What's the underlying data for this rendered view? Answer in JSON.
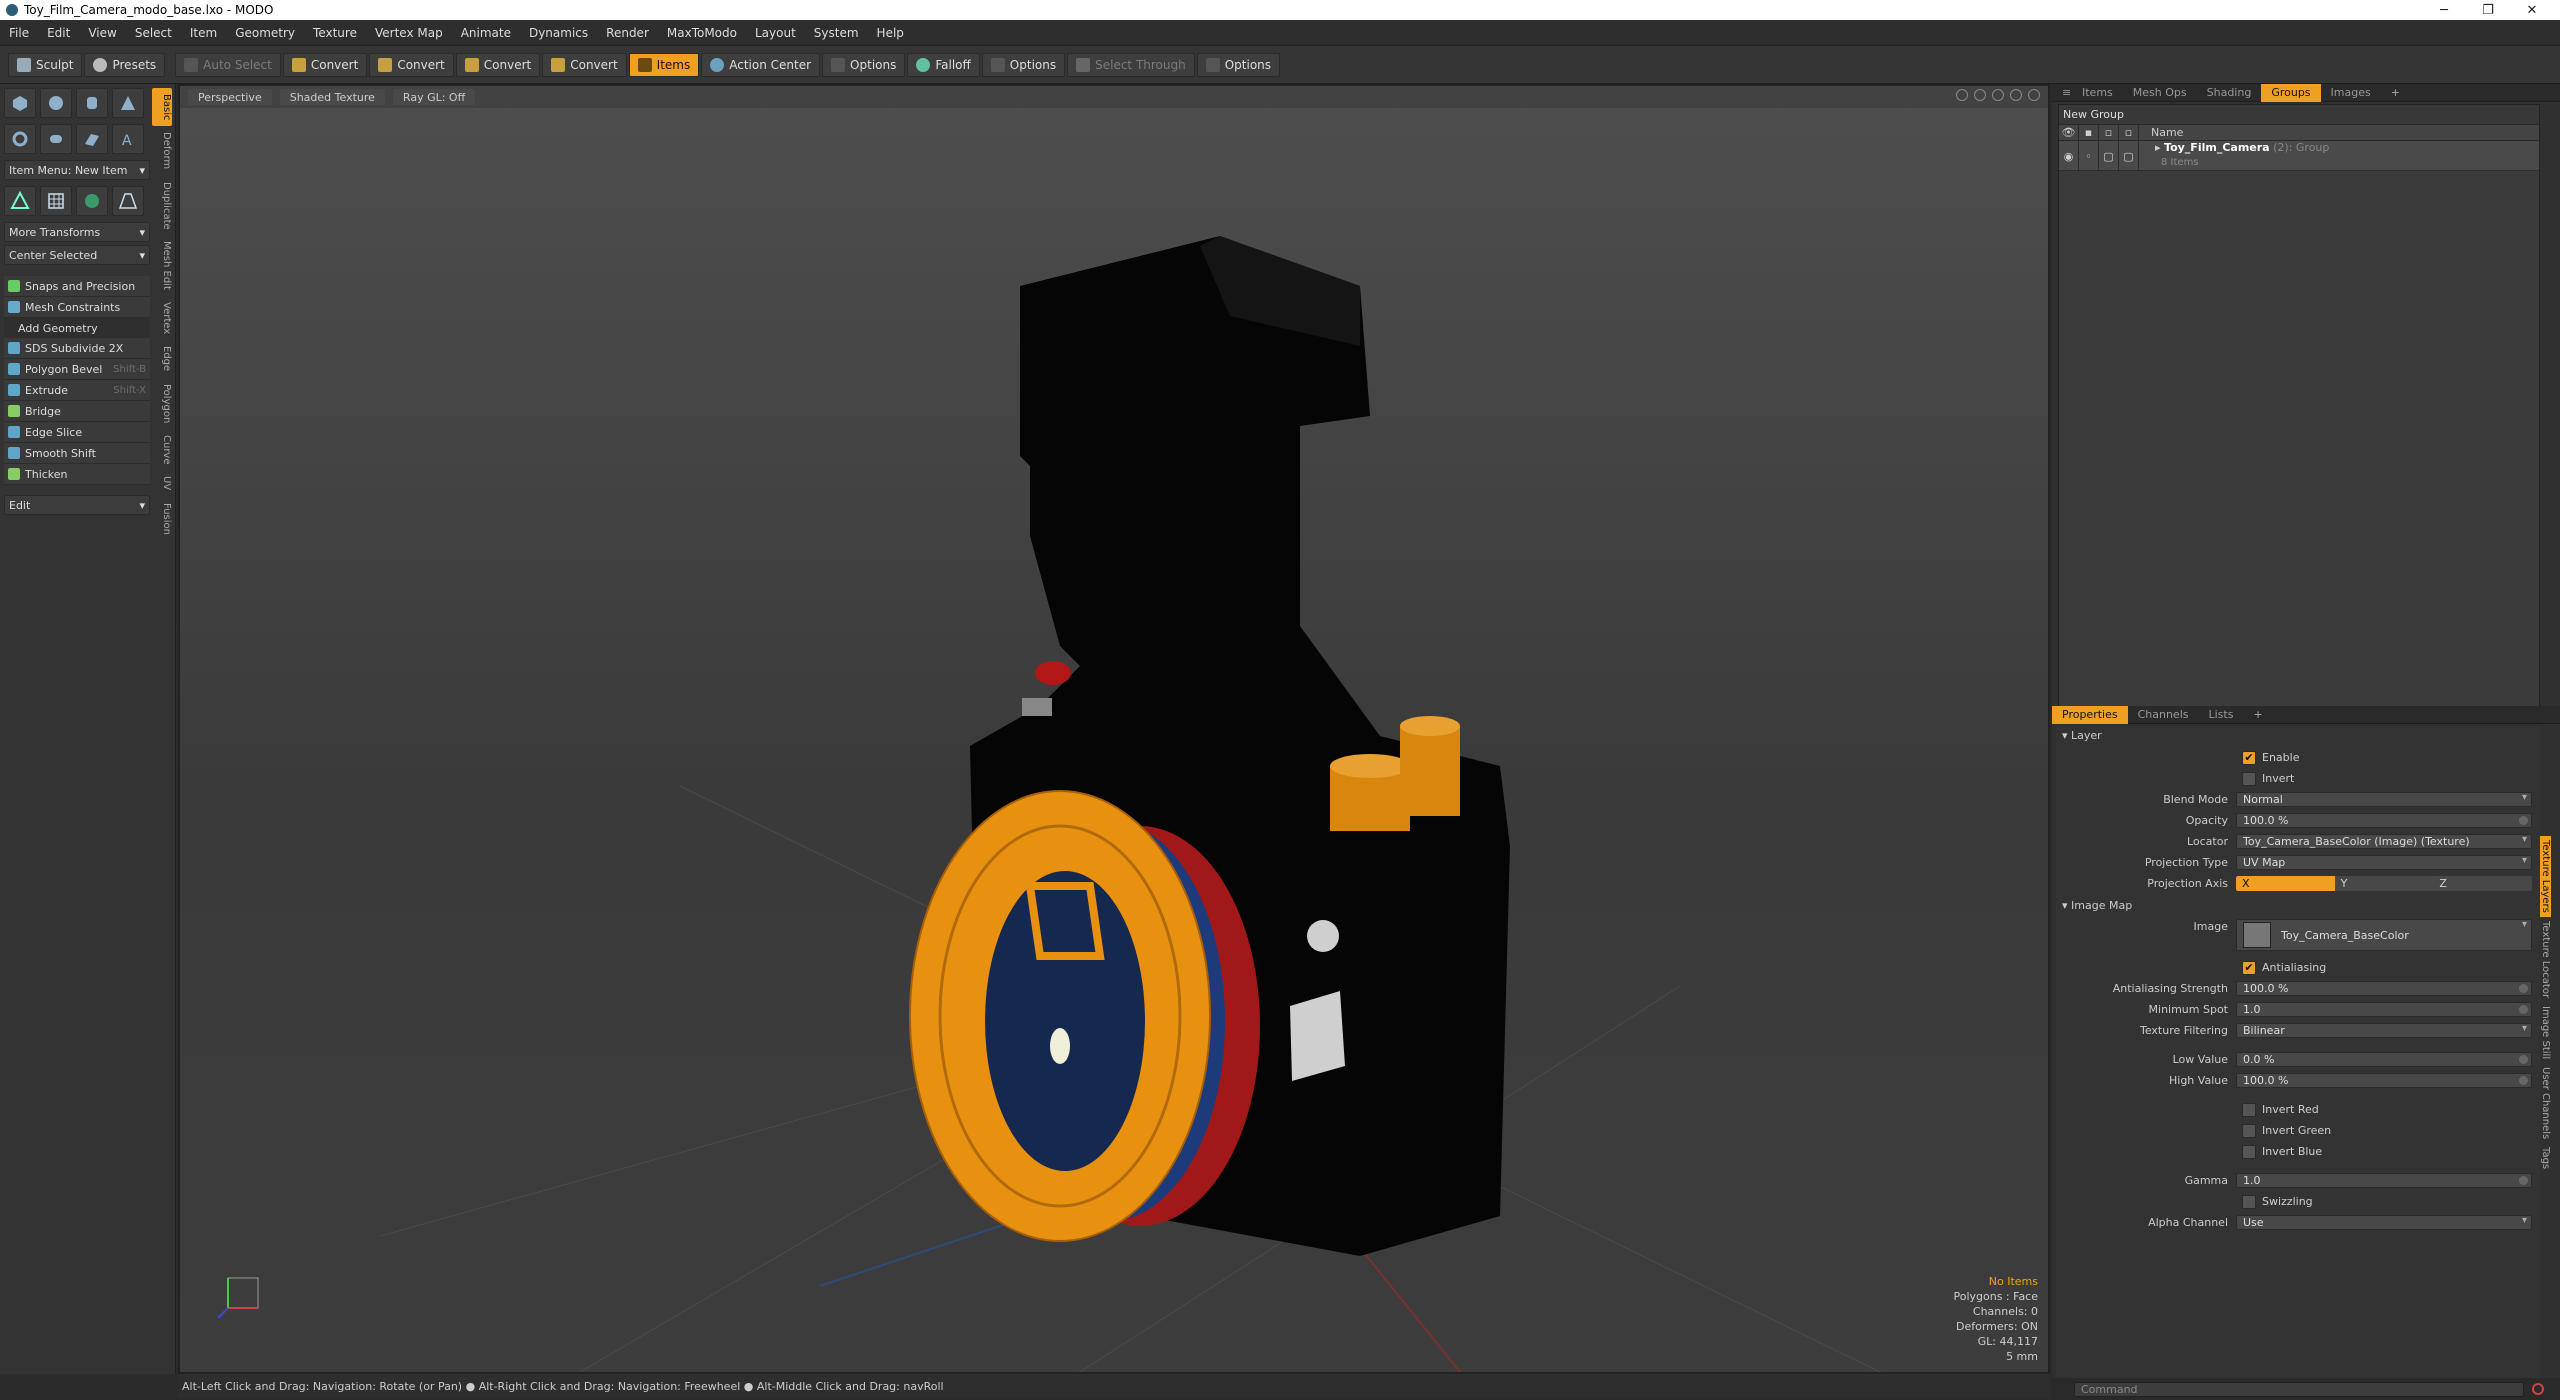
{
  "window": {
    "title": "Toy_Film_Camera_modo_base.lxo - MODO"
  },
  "menu": [
    "File",
    "Edit",
    "View",
    "Select",
    "Item",
    "Geometry",
    "Texture",
    "Vertex Map",
    "Animate",
    "Dynamics",
    "Render",
    "MaxToModo",
    "Layout",
    "System",
    "Help"
  ],
  "toolbar": {
    "sculpt": "Sculpt",
    "presets": "Presets",
    "auto_select": "Auto Select",
    "convert1": "Convert",
    "convert2": "Convert",
    "convert3": "Convert",
    "convert4": "Convert",
    "items": "Items",
    "action_center": "Action Center",
    "options1": "Options",
    "falloff": "Falloff",
    "options2": "Options",
    "select_through": "Select Through",
    "options3": "Options"
  },
  "left_tabs": [
    "Basic",
    "Deform",
    "Duplicate",
    "Mesh Edit",
    "Vertex",
    "Edge",
    "Polygon",
    "Curve",
    "UV",
    "Fusion"
  ],
  "left": {
    "item_menu": "Item Menu: New Item",
    "more_transforms": "More Transforms",
    "center_selected": "Center Selected",
    "snaps": "Snaps and Precision",
    "mesh_constraints": "Mesh Constraints",
    "add_geometry": "Add Geometry",
    "tools": [
      {
        "label": "SDS Subdivide 2X",
        "shortcut": ""
      },
      {
        "label": "Polygon Bevel",
        "shortcut": "Shift-B"
      },
      {
        "label": "Extrude",
        "shortcut": "Shift-X"
      },
      {
        "label": "Bridge",
        "shortcut": ""
      },
      {
        "label": "Edge Slice",
        "shortcut": ""
      },
      {
        "label": "Smooth Shift",
        "shortcut": ""
      },
      {
        "label": "Thicken",
        "shortcut": ""
      }
    ],
    "edit": "Edit"
  },
  "viewport": {
    "view": "Perspective",
    "shading": "Shaded Texture",
    "raygl": "Ray GL: Off",
    "stats": {
      "items": "No Items",
      "polygons": "Polygons : Face",
      "channels": "Channels: 0",
      "deformers": "Deformers: ON",
      "gl": "GL: 44,117",
      "units": "5 mm"
    }
  },
  "status": "Alt-Left Click and Drag: Navigation: Rotate (or Pan) ● Alt-Right Click and Drag: Navigation: Freewheel ● Alt-Middle Click and Drag: navRoll",
  "right_tabs": [
    "Items",
    "Mesh Ops",
    "Shading",
    "Groups",
    "Images"
  ],
  "groups": {
    "new_group": "New Group",
    "name_col": "Name",
    "item_name": "Toy_Film_Camera",
    "item_count": "(2)",
    "item_type": ": Group",
    "item_sub": "8 Items"
  },
  "prop_tabs": [
    "Properties",
    "Channels",
    "Lists"
  ],
  "props": {
    "layer": "Layer",
    "enable": "Enable",
    "invert": "Invert",
    "blend_mode_l": "Blend Mode",
    "blend_mode": "Normal",
    "opacity_l": "Opacity",
    "opacity": "100.0 %",
    "locator_l": "Locator",
    "locator": "Toy_Camera_BaseColor (Image) (Texture)",
    "proj_type_l": "Projection Type",
    "proj_type": "UV Map",
    "proj_axis_l": "Projection Axis",
    "axis_x": "X",
    "axis_y": "Y",
    "axis_z": "Z",
    "image_map": "Image Map",
    "image_l": "Image",
    "image": "Toy_Camera_BaseColor",
    "antialiasing": "Antialiasing",
    "aa_strength_l": "Antialiasing Strength",
    "aa_strength": "100.0 %",
    "min_spot_l": "Minimum Spot",
    "min_spot": "1.0",
    "tex_filter_l": "Texture Filtering",
    "tex_filter": "Bilinear",
    "low_l": "Low Value",
    "low": "0.0 %",
    "high_l": "High Value",
    "high": "100.0 %",
    "invert_red": "Invert Red",
    "invert_green": "Invert Green",
    "invert_blue": "Invert Blue",
    "gamma_l": "Gamma",
    "gamma": "1.0",
    "swizzling": "Swizzling",
    "alpha_l": "Alpha Channel",
    "alpha": "Use"
  },
  "side_tabs": [
    "Texture Layers",
    "Texture Locator",
    "Image Still",
    "User Channels",
    "Tags"
  ],
  "command": "Command",
  "colors": {
    "accent": "#f0a020",
    "lens_orange": "#e8900f",
    "camera_body": "#050505",
    "red_ring": "#a01818",
    "blue_ring": "#1d3b7a"
  }
}
